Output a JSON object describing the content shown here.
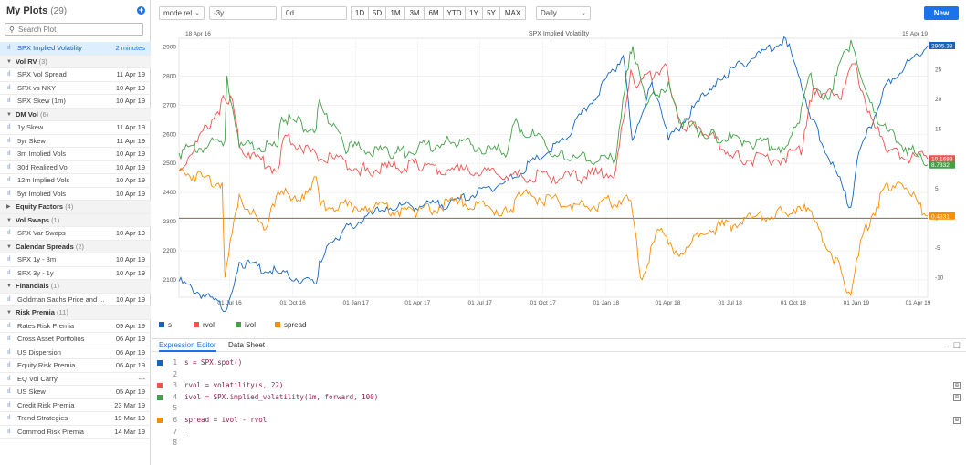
{
  "sidebar": {
    "title": "My Plots",
    "count": "(29)",
    "search_placeholder": "Search Plot",
    "rows": [
      {
        "kind": "item",
        "name": "SPX Implied Volatility",
        "date": "2 minutes",
        "active": true
      },
      {
        "kind": "group",
        "name": "Vol RV",
        "count": "(3)",
        "open": true
      },
      {
        "kind": "item",
        "name": "SPX Vol Spread",
        "date": "11 Apr 19"
      },
      {
        "kind": "item",
        "name": "SPX vs NKY",
        "date": "10 Apr 19"
      },
      {
        "kind": "item",
        "name": "SPX Skew (1m)",
        "date": "10 Apr 19"
      },
      {
        "kind": "group",
        "name": "DM Vol",
        "count": "(6)",
        "open": true
      },
      {
        "kind": "item",
        "name": "1y Skew",
        "date": "11 Apr 19"
      },
      {
        "kind": "item",
        "name": "5yr Skew",
        "date": "11 Apr 19"
      },
      {
        "kind": "item",
        "name": "3m Implied Vols",
        "date": "10 Apr 19"
      },
      {
        "kind": "item",
        "name": "30d Realized Vol",
        "date": "10 Apr 19"
      },
      {
        "kind": "item",
        "name": "12m Implied Vols",
        "date": "10 Apr 19"
      },
      {
        "kind": "item",
        "name": "5yr Implied Vols",
        "date": "10 Apr 19"
      },
      {
        "kind": "group",
        "name": "Equity Factors",
        "count": "(4)",
        "open": false
      },
      {
        "kind": "group",
        "name": "Vol Swaps",
        "count": "(1)",
        "open": true
      },
      {
        "kind": "item",
        "name": "SPX Var Swaps",
        "date": "10 Apr 19"
      },
      {
        "kind": "group",
        "name": "Calendar Spreads",
        "count": "(2)",
        "open": true
      },
      {
        "kind": "item",
        "name": "SPX 1y - 3m",
        "date": "10 Apr 19"
      },
      {
        "kind": "item",
        "name": "SPX 3y - 1y",
        "date": "10 Apr 19"
      },
      {
        "kind": "group",
        "name": "Financials",
        "count": "(1)",
        "open": true
      },
      {
        "kind": "item",
        "name": "Goldman Sachs Price and ...",
        "date": "10 Apr 19"
      },
      {
        "kind": "group",
        "name": "Risk Premia",
        "count": "(11)",
        "open": true
      },
      {
        "kind": "item",
        "name": "Rates Risk Premia",
        "date": "09 Apr 19"
      },
      {
        "kind": "item",
        "name": "Cross Asset Portfolios",
        "date": "06 Apr 19"
      },
      {
        "kind": "item",
        "name": "US Dispersion",
        "date": "06 Apr 19"
      },
      {
        "kind": "item",
        "name": "Equity Risk Premia",
        "date": "06 Apr 19"
      },
      {
        "kind": "item",
        "name": "EQ Vol Carry",
        "date": "---"
      },
      {
        "kind": "item",
        "name": "US Skew",
        "date": "05 Apr 19"
      },
      {
        "kind": "item",
        "name": "Credit Risk Premia",
        "date": "23 Mar 19"
      },
      {
        "kind": "item",
        "name": "Trend Strategies",
        "date": "19 Mar 19"
      },
      {
        "kind": "item",
        "name": "Commod Risk Premia",
        "date": "14 Mar 19"
      }
    ]
  },
  "toolbar": {
    "mode": "mode rel",
    "start": "-3y",
    "end": "0d",
    "periods": [
      "1D",
      "5D",
      "1M",
      "3M",
      "6M",
      "YTD",
      "1Y",
      "5Y",
      "MAX"
    ],
    "frequency": "Daily",
    "new_label": "New"
  },
  "chart_data": {
    "type": "line",
    "title": "SPX Implied Volatility",
    "date_start": "18 Apr 16",
    "date_end": "15 Apr 19",
    "x_ticks": [
      "01 Jul 16",
      "01 Oct 16",
      "01 Jan 17",
      "01 Apr 17",
      "01 Jul 17",
      "01 Oct 17",
      "01 Jan 18",
      "01 Apr 18",
      "01 Jul 18",
      "01 Oct 18",
      "01 Jan 19",
      "01 Apr 19"
    ],
    "y_left": {
      "ticks": [
        2100,
        2200,
        2300,
        2400,
        2500,
        2600,
        2700,
        2800,
        2900
      ],
      "lim": [
        2040,
        2930
      ]
    },
    "y_right": {
      "ticks": [
        -10,
        -5,
        0,
        5,
        10,
        15,
        20,
        25
      ],
      "lim": [
        -13.3,
        30.3
      ]
    },
    "grid": true,
    "legend_position": "bottom",
    "series": [
      {
        "name": "s",
        "color": "#1565c0",
        "axis": "left",
        "last_label": "2905.38",
        "x": [
          "2016-04-18",
          "2016-06-27",
          "2016-07-15",
          "2016-09-09",
          "2016-11-04",
          "2016-11-09",
          "2016-12-13",
          "2017-02-15",
          "2017-05-17",
          "2017-08-10",
          "2017-11-01",
          "2018-01-26",
          "2018-02-08",
          "2018-03-09",
          "2018-04-02",
          "2018-06-12",
          "2018-09-20",
          "2018-10-29",
          "2018-12-24",
          "2019-01-02",
          "2019-02-15",
          "2019-04-15"
        ],
        "values": [
          2095,
          2000,
          2160,
          2125,
          2085,
          2165,
          2270,
          2350,
          2360,
          2440,
          2580,
          2870,
          2580,
          2780,
          2580,
          2790,
          2930,
          2650,
          2350,
          2510,
          2780,
          2905
        ]
      },
      {
        "name": "rvol",
        "color": "#ef5350",
        "axis": "right",
        "last_label": "10.1683",
        "x": [
          "2016-04-18",
          "2016-06-24",
          "2016-07-05",
          "2016-07-15",
          "2016-09-09",
          "2016-09-20",
          "2016-11-10",
          "2016-12-01",
          "2017-01-15",
          "2017-04-01",
          "2017-06-01",
          "2017-09-01",
          "2017-12-01",
          "2018-01-15",
          "2018-02-06",
          "2018-02-15",
          "2018-03-28",
          "2018-04-20",
          "2018-06-01",
          "2018-07-15",
          "2018-09-15",
          "2018-10-15",
          "2018-10-30",
          "2018-12-10",
          "2018-12-28",
          "2019-01-20",
          "2019-02-15",
          "2019-04-15"
        ],
        "values": [
          8,
          20,
          20,
          12,
          8,
          14,
          10,
          10,
          8,
          9,
          8,
          7,
          7,
          8,
          25,
          22,
          26,
          16,
          14,
          10,
          10,
          12,
          22,
          20,
          26,
          18,
          11,
          10
        ]
      },
      {
        "name": "ivol",
        "color": "#43a047",
        "axis": "right",
        "last_label": "8.7332",
        "x": [
          "2016-04-18",
          "2016-06-24",
          "2016-06-27",
          "2016-07-15",
          "2016-09-09",
          "2016-09-15",
          "2016-11-04",
          "2016-11-09",
          "2016-12-15",
          "2017-03-01",
          "2017-05-17",
          "2017-08-10",
          "2017-08-20",
          "2017-11-01",
          "2018-01-15",
          "2018-02-05",
          "2018-02-09",
          "2018-03-01",
          "2018-04-02",
          "2018-04-20",
          "2018-06-01",
          "2018-09-15",
          "2018-10-10",
          "2018-10-24",
          "2018-11-20",
          "2018-12-24",
          "2019-01-02",
          "2019-02-01",
          "2019-04-15"
        ],
        "values": [
          11,
          13,
          24,
          12,
          12,
          17,
          15,
          20,
          12,
          11,
          13,
          11,
          16,
          10,
          10,
          28,
          29,
          19,
          23,
          16,
          14,
          12,
          16,
          24,
          20,
          30,
          26,
          16,
          9
        ]
      },
      {
        "name": "spread",
        "color": "#fb8c00",
        "axis": "right",
        "last_label": "0.4331",
        "x": [
          "2016-04-18",
          "2016-06-20",
          "2016-06-24",
          "2016-07-15",
          "2016-08-20",
          "2016-09-12",
          "2016-10-15",
          "2016-11-04",
          "2016-11-10",
          "2017-01-15",
          "2017-04-01",
          "2017-06-01",
          "2017-08-10",
          "2017-09-01",
          "2017-12-01",
          "2018-01-20",
          "2018-02-06",
          "2018-02-20",
          "2018-03-20",
          "2018-04-10",
          "2018-06-01",
          "2018-08-01",
          "2018-09-15",
          "2018-10-10",
          "2018-10-30",
          "2018-12-10",
          "2018-12-24",
          "2019-01-10",
          "2019-02-15",
          "2019-03-20",
          "2019-04-15"
        ],
        "values": [
          8,
          6,
          -10,
          4,
          -2,
          4,
          4,
          7,
          2,
          2,
          1,
          3,
          1,
          4,
          2,
          3,
          3,
          -10,
          -2,
          -6,
          -2,
          0,
          1,
          2,
          0,
          -9,
          -13,
          -3,
          6,
          4,
          0.4
        ]
      }
    ]
  },
  "legend": [
    {
      "name": "s",
      "color": "#1565c0"
    },
    {
      "name": "rvol",
      "color": "#ef5350"
    },
    {
      "name": "ivol",
      "color": "#43a047"
    },
    {
      "name": "spread",
      "color": "#fb8c00"
    }
  ],
  "editor": {
    "tabs": [
      "Expression Editor",
      "Data Sheet"
    ],
    "lines": [
      {
        "no": "1",
        "text": "s = SPX.spot()",
        "marker": "#1565c0",
        "icon": false
      },
      {
        "no": "2",
        "text": "",
        "marker": "",
        "icon": false
      },
      {
        "no": "3",
        "text": "rvol = volatility(s, 22)",
        "marker": "#ef5350",
        "icon": true
      },
      {
        "no": "4",
        "text": "ivol = SPX.implied_volatility(1m, forward, 100)",
        "marker": "#43a047",
        "icon": true
      },
      {
        "no": "5",
        "text": "",
        "marker": "",
        "icon": false
      },
      {
        "no": "6",
        "text": "spread = ivol - rvol",
        "marker": "#fb8c00",
        "icon": true
      },
      {
        "no": "7",
        "text": "",
        "marker": "",
        "icon": false
      },
      {
        "no": "8",
        "text": "",
        "marker": "",
        "icon": false
      }
    ]
  }
}
